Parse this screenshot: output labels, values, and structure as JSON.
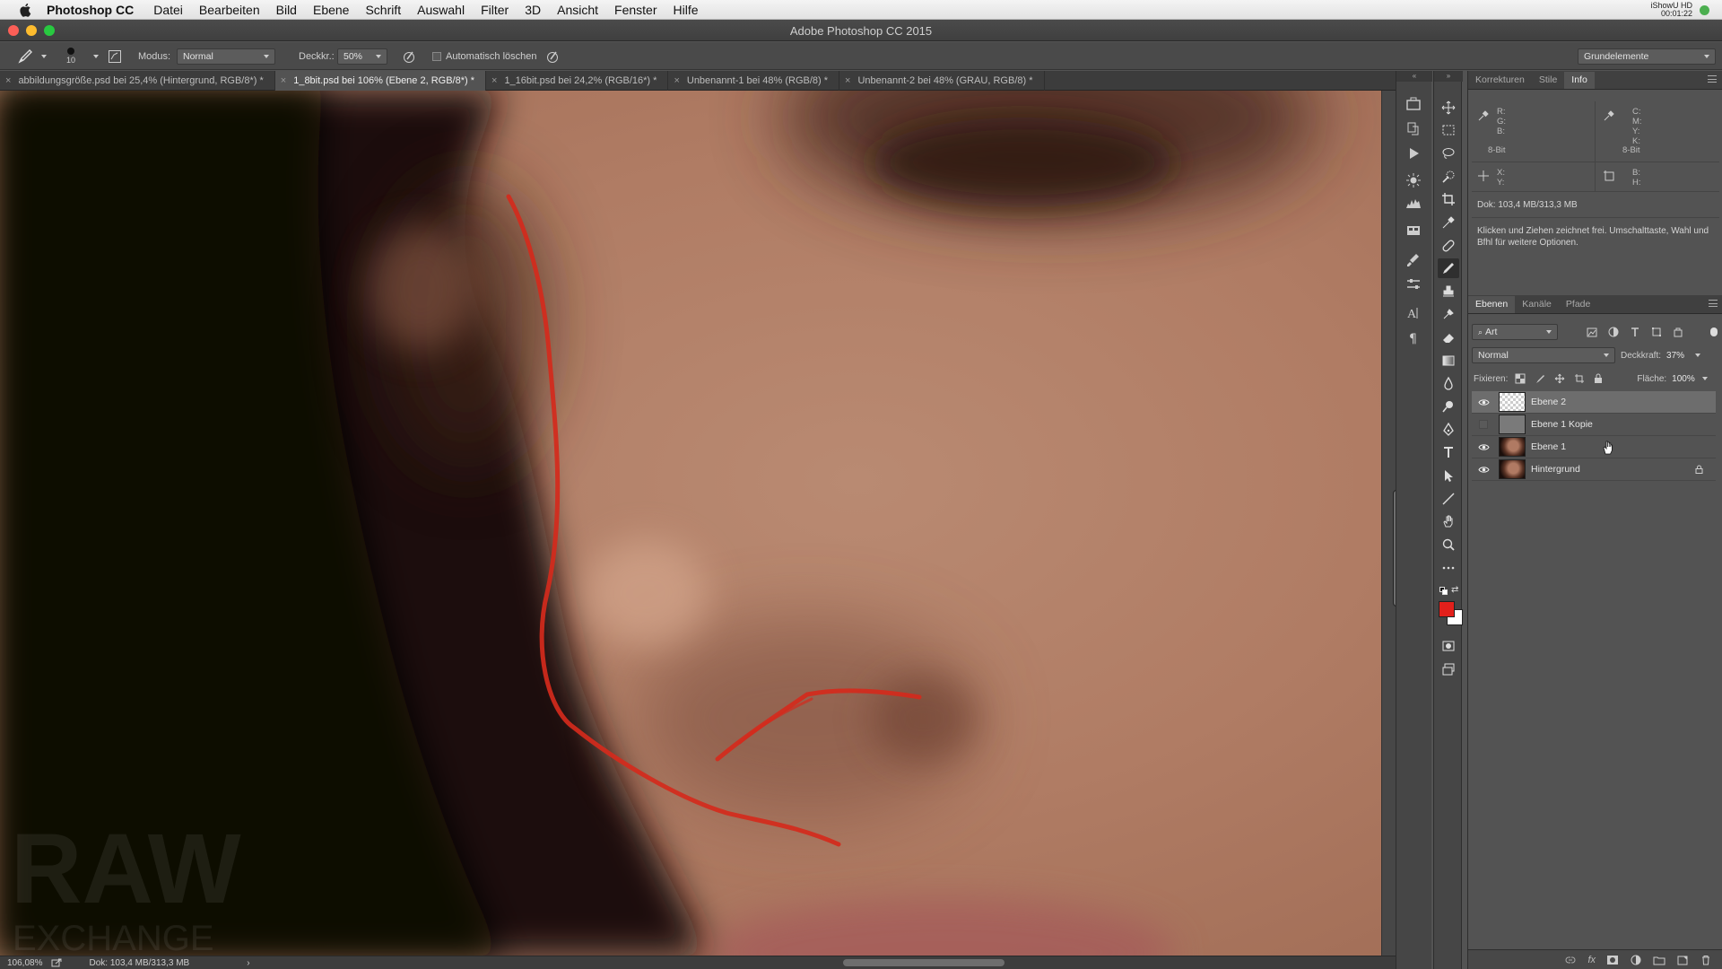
{
  "menubar": {
    "app_name": "Photoshop CC",
    "items": [
      "Datei",
      "Bearbeiten",
      "Bild",
      "Ebene",
      "Schrift",
      "Auswahl",
      "Filter",
      "3D",
      "Ansicht",
      "Fenster",
      "Hilfe"
    ],
    "status_title": "iShowU HD",
    "status_time": "00:01:22"
  },
  "window": {
    "title": "Adobe Photoshop CC 2015"
  },
  "options": {
    "brush_size": "10",
    "mode_label": "Modus:",
    "mode_value": "Normal",
    "opacity_label": "Deckkr.:",
    "opacity_value": "50%",
    "auto_erase_label": "Automatisch löschen",
    "workspace": "Grundelemente"
  },
  "tabs": [
    {
      "label": "abbildungsgröße.psd bei 25,4% (Hintergrund, RGB/8*) *",
      "active": false
    },
    {
      "label": "1_8bit.psd bei 106% (Ebene 2, RGB/8*) *",
      "active": true
    },
    {
      "label": "1_16bit.psd bei 24,2% (RGB/16*) *",
      "active": false
    },
    {
      "label": "Unbenannt-1 bei 48% (RGB/8) *",
      "active": false
    },
    {
      "label": "Unbenannt-2 bei 48% (GRAU, RGB/8) *",
      "active": false
    }
  ],
  "canvas": {
    "watermark_line1": "RAW",
    "watermark_line2": "EXCHANGE"
  },
  "statusbar": {
    "zoom": "106,08%",
    "doc": "Dok: 103,4 MB/313,3 MB",
    "arrow": "›"
  },
  "info_panel": {
    "tabs": [
      "Korrekturen",
      "Stile",
      "Info"
    ],
    "active_tab": "Info",
    "rgb_labels": [
      "R:",
      "G:",
      "B:"
    ],
    "cmyk_labels": [
      "C:",
      "M:",
      "Y:",
      "K:"
    ],
    "bitdepth_left": "8-Bit",
    "bitdepth_right": "8-Bit",
    "xy_labels": [
      "X:",
      "Y:"
    ],
    "bh_labels": [
      "B:",
      "H:"
    ],
    "doc": "Dok: 103,4 MB/313,3 MB",
    "hint": "Klicken und Ziehen zeichnet frei. Umschalttaste, Wahl und Bfhl für weitere Optionen."
  },
  "layers_panel": {
    "tabs": [
      "Ebenen",
      "Kanäle",
      "Pfade"
    ],
    "active_tab": "Ebenen",
    "filter_kind": "Art",
    "blend_mode": "Normal",
    "opacity_label": "Deckkraft:",
    "opacity_value": "37%",
    "lock_label": "Fixieren:",
    "fill_label": "Fläche:",
    "fill_value": "100%",
    "layers": [
      {
        "name": "Ebene 2",
        "visible": true,
        "selected": true,
        "thumb": "transparent"
      },
      {
        "name": "Ebene 1 Kopie",
        "visible": false,
        "selected": false,
        "thumb": "gray"
      },
      {
        "name": "Ebene 1",
        "visible": true,
        "selected": false,
        "thumb": "photo"
      },
      {
        "name": "Hintergrund",
        "visible": true,
        "selected": false,
        "thumb": "photo",
        "locked": true
      }
    ],
    "footer_fx": "fx"
  },
  "colors": {
    "foreground": "#e3201b",
    "background": "#ffffff",
    "stroke": "#d42a1c"
  }
}
